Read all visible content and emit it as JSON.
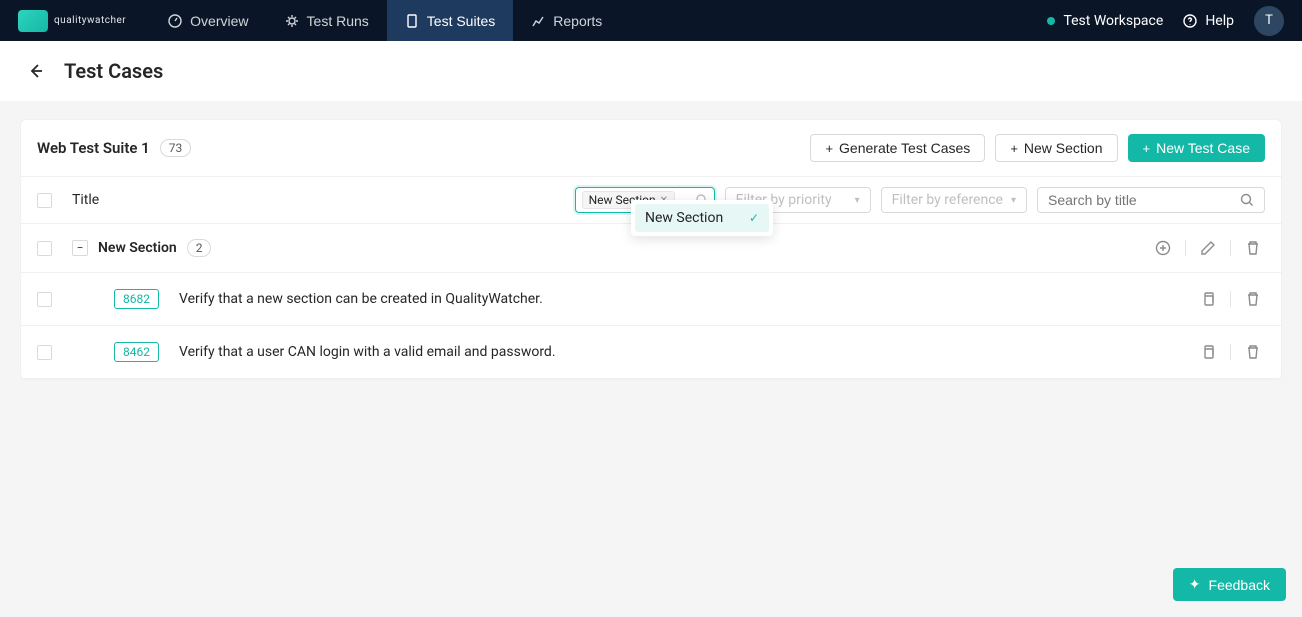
{
  "brand": {
    "name": "qualitywatcher"
  },
  "nav": {
    "overview": "Overview",
    "test_runs": "Test Runs",
    "test_suites": "Test Suites",
    "reports": "Reports"
  },
  "topbar": {
    "workspace": "Test Workspace",
    "help": "Help",
    "avatar_initial": "T"
  },
  "page": {
    "title": "Test Cases"
  },
  "suite": {
    "name": "Web Test Suite 1",
    "count": "73"
  },
  "actions": {
    "generate": "Generate Test Cases",
    "new_section": "New Section",
    "new_case": "New Test Case"
  },
  "columns": {
    "title": "Title"
  },
  "filters": {
    "section_tag": "New Section",
    "priority_placeholder": "Filter by priority",
    "reference_placeholder": "Filter by reference",
    "search_placeholder": "Search by title"
  },
  "dropdown": {
    "option1": "New Section"
  },
  "section": {
    "title": "New Section",
    "count": "2"
  },
  "cases": {
    "c1": {
      "id": "8682",
      "title": "Verify that a new section can be created in QualityWatcher."
    },
    "c2": {
      "id": "8462",
      "title": "Verify that a user CAN login with a valid email and password."
    }
  },
  "feedback": "Feedback",
  "colors": {
    "accent": "#14b8a6",
    "topbar": "#0a1628"
  }
}
